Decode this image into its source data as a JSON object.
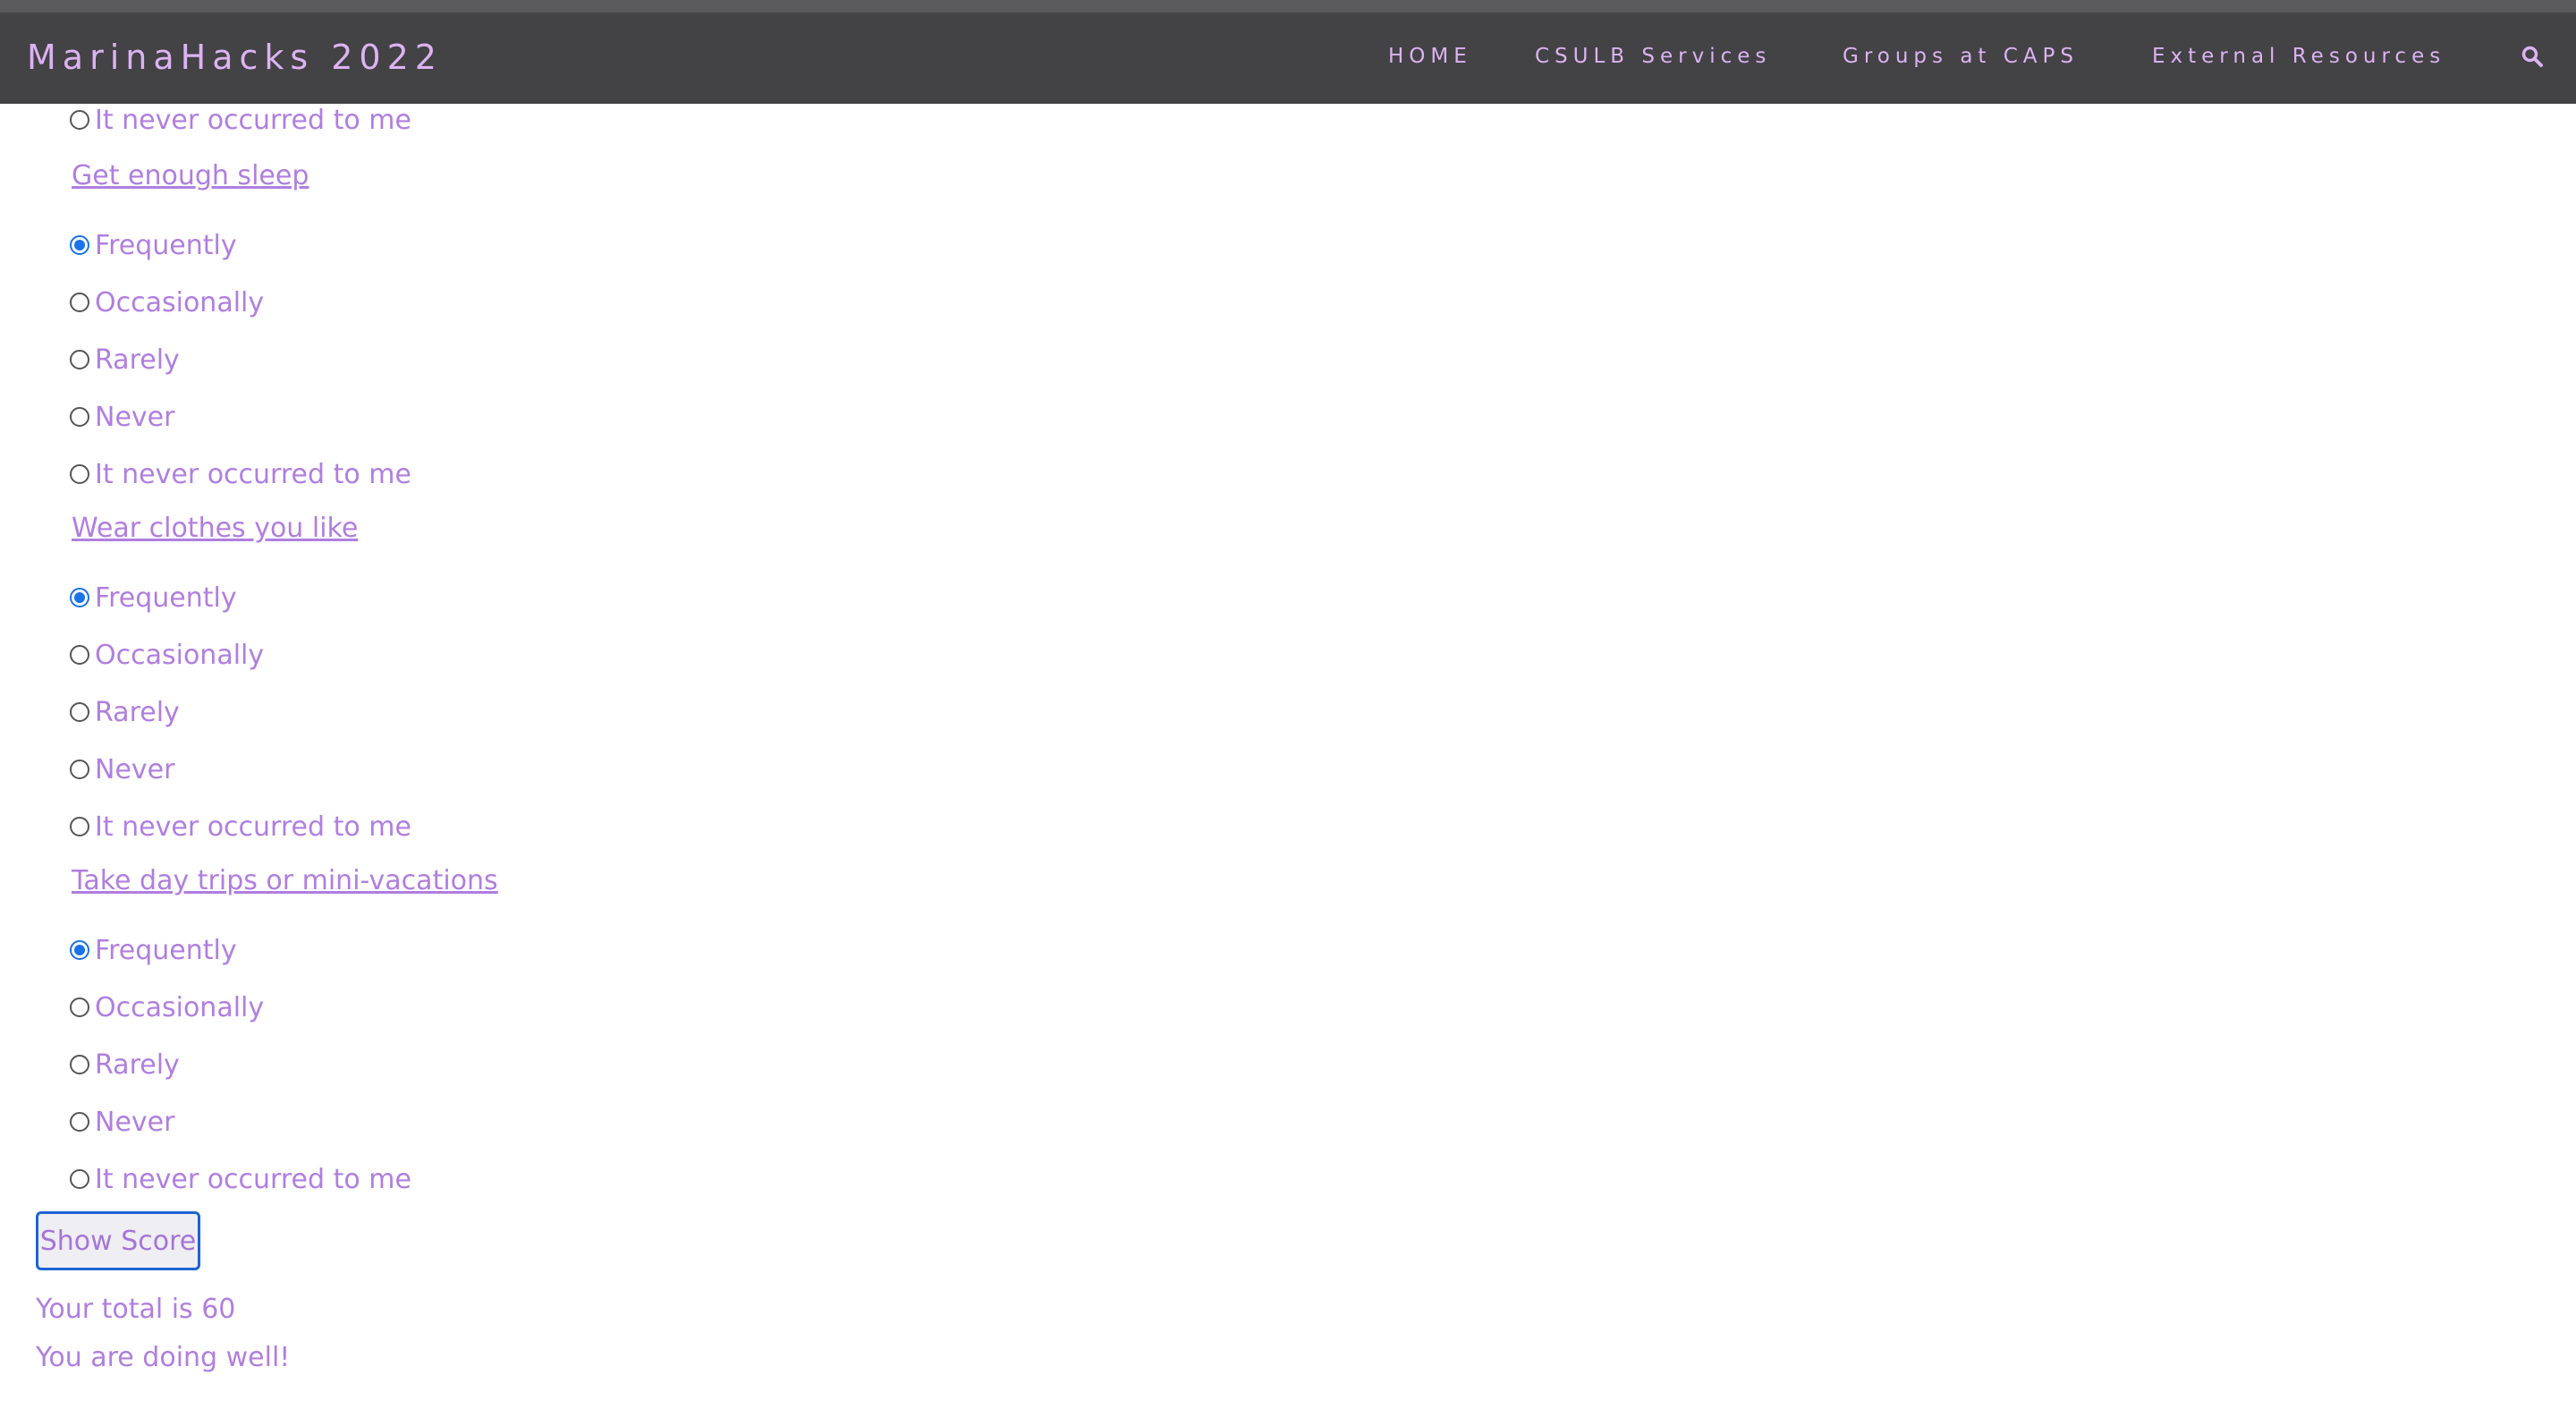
{
  "navbar": {
    "brand": "MarinaHacks 2022",
    "links": [
      "HOME",
      "CSULB Services",
      "Groups at CAPS",
      "External Resources"
    ],
    "search_icon": "search-icon"
  },
  "top_partial_option": {
    "label": "It never occurred to me",
    "checked": false
  },
  "questions": [
    {
      "title": "Get enough sleep",
      "options": [
        {
          "label": "Frequently",
          "checked": true
        },
        {
          "label": "Occasionally",
          "checked": false
        },
        {
          "label": "Rarely",
          "checked": false
        },
        {
          "label": "Never",
          "checked": false
        },
        {
          "label": "It never occurred to me",
          "checked": false
        }
      ]
    },
    {
      "title": "Wear clothes you like",
      "options": [
        {
          "label": "Frequently",
          "checked": true
        },
        {
          "label": "Occasionally",
          "checked": false
        },
        {
          "label": "Rarely",
          "checked": false
        },
        {
          "label": "Never",
          "checked": false
        },
        {
          "label": "It never occurred to me",
          "checked": false
        }
      ]
    },
    {
      "title": "Take day trips or mini-vacations",
      "options": [
        {
          "label": "Frequently",
          "checked": true
        },
        {
          "label": "Occasionally",
          "checked": false
        },
        {
          "label": "Rarely",
          "checked": false
        },
        {
          "label": "Never",
          "checked": false
        },
        {
          "label": "It never occurred to me",
          "checked": false
        }
      ]
    }
  ],
  "show_score_label": "Show Score",
  "total_text": "Your total is 60",
  "status_text": "You are doing well!"
}
